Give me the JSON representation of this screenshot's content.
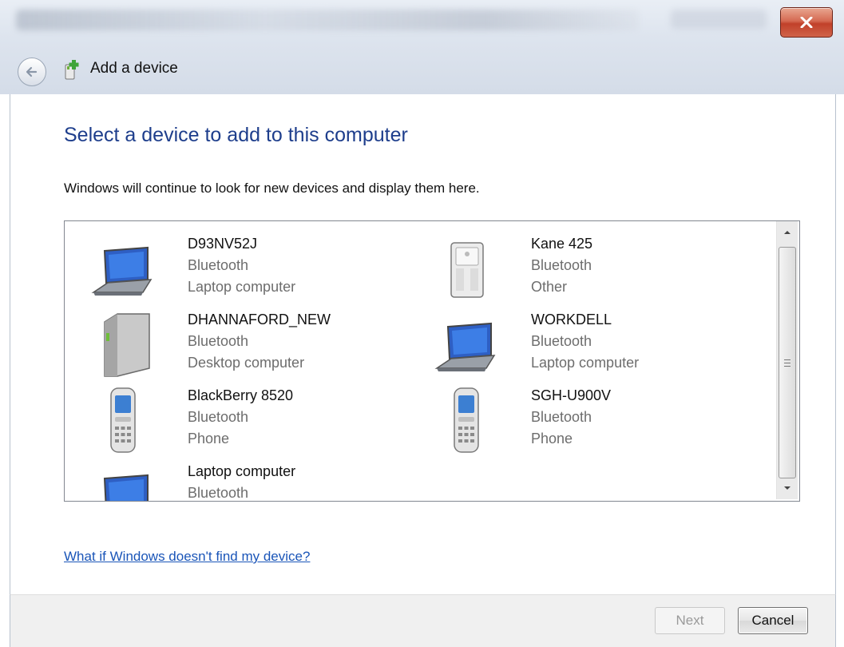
{
  "window": {
    "title": "Add a device",
    "close_icon": "close-icon",
    "back_icon": "back-arrow-icon",
    "title_icon": "add-device-icon"
  },
  "main": {
    "heading": "Select a device to add to this computer",
    "subtext": "Windows will continue to look for new devices and display them here.",
    "help_link": "What if Windows doesn't find my device?"
  },
  "devices": [
    {
      "name": "D93NV52J",
      "connection": "Bluetooth",
      "type": "Laptop computer",
      "icon": "laptop-icon"
    },
    {
      "name": "Kane 425",
      "connection": "Bluetooth",
      "type": "Other",
      "icon": "device-tower-icon"
    },
    {
      "name": "DHANNAFORD_NEW",
      "connection": "Bluetooth",
      "type": "Desktop computer",
      "icon": "desktop-tower-icon"
    },
    {
      "name": "WORKDELL",
      "connection": "Bluetooth",
      "type": "Laptop computer",
      "icon": "laptop-icon"
    },
    {
      "name": "BlackBerry 8520",
      "connection": "Bluetooth",
      "type": "Phone",
      "icon": "phone-icon"
    },
    {
      "name": "SGH-U900V",
      "connection": "Bluetooth",
      "type": "Phone",
      "icon": "phone-icon"
    },
    {
      "name": "Laptop computer",
      "connection": "Bluetooth",
      "type": "",
      "icon": "laptop-icon"
    }
  ],
  "footer": {
    "next_label": "Next",
    "cancel_label": "Cancel"
  },
  "colors": {
    "heading": "#1e3e8c",
    "link": "#1a55b8",
    "secondary_text": "#6d6d6d",
    "close_button": "#c1412a"
  }
}
